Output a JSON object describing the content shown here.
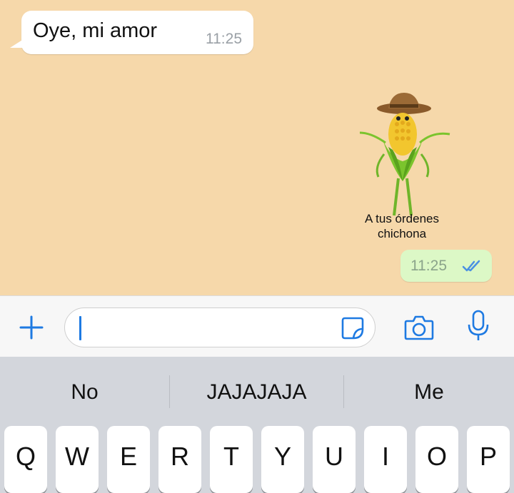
{
  "chat": {
    "incoming": {
      "text": "Oye, mi amor",
      "time": "11:25"
    },
    "sticker": {
      "caption_line1": "A tus órdenes",
      "caption_line2": "chichona"
    },
    "outgoing": {
      "time": "11:25",
      "status_icon": "double-check-read-icon"
    }
  },
  "input_bar": {
    "add_icon": "plus-icon",
    "field_placeholder": "",
    "sticker_icon": "sticker-icon",
    "camera_icon": "camera-icon",
    "mic_icon": "microphone-icon"
  },
  "keyboard": {
    "suggestions": [
      "No",
      "JAJAJAJA",
      "Me"
    ],
    "top_row": [
      "Q",
      "W",
      "E",
      "R",
      "T",
      "Y",
      "U",
      "I",
      "O",
      "P"
    ]
  },
  "colors": {
    "chat_background": "#f6d8aa",
    "outgoing_bubble": "#dcf8c6",
    "accent_blue": "#1e7ae2",
    "keyboard_bg": "#d3d6dc"
  }
}
